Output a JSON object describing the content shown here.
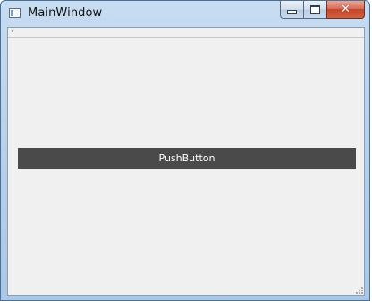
{
  "window": {
    "title": "MainWindow",
    "caption_buttons": {
      "minimize_icon": "minimize-icon",
      "maximize_icon": "maximize-icon",
      "close_icon": "close-icon",
      "close_glyph": "✕"
    }
  },
  "main": {
    "push_button_label": "PushButton"
  },
  "colors": {
    "button_background": "#4a4a4a",
    "button_text": "#ffffff",
    "client_background": "#f0f0f0",
    "close_button": "#c3442b"
  }
}
